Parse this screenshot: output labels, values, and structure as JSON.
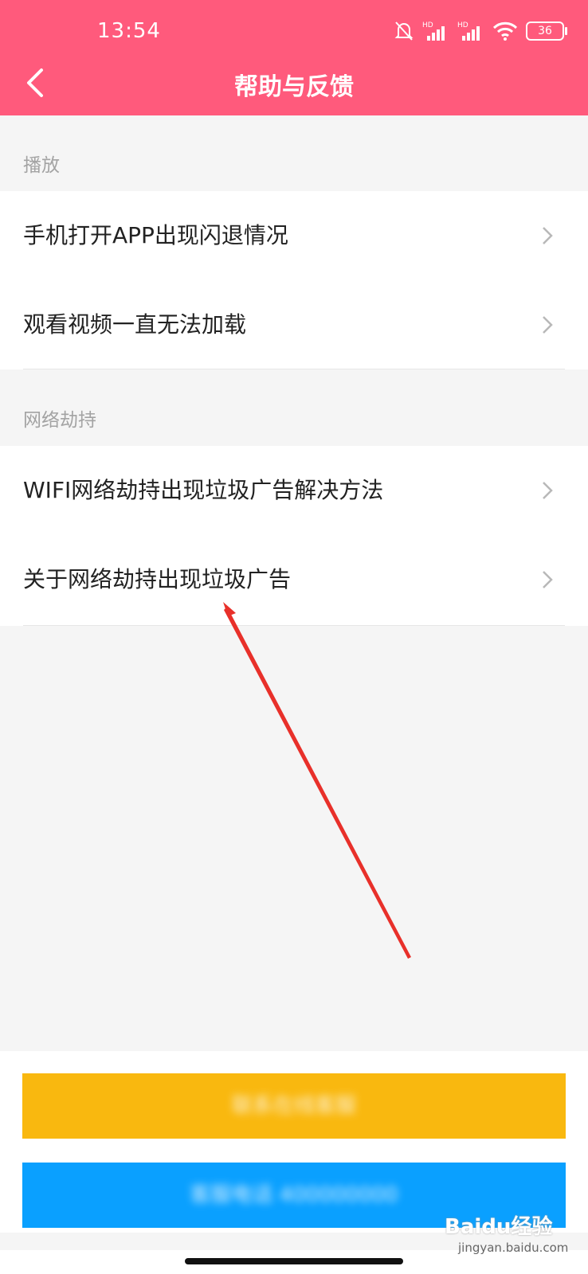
{
  "status_bar": {
    "time": "13:54",
    "battery": "36"
  },
  "nav": {
    "title": "帮助与反馈"
  },
  "sections": [
    {
      "label": "播放",
      "items": [
        "手机打开APP出现闪退情况",
        "观看视频一直无法加载"
      ]
    },
    {
      "label": "网络劫持",
      "items": [
        "WIFI网络劫持出现垃圾广告解决方法",
        "关于网络劫持出现垃圾广告"
      ]
    }
  ],
  "buttons": {
    "primary_label": "联系在线客服",
    "secondary_label": "客服电话 400000000"
  },
  "watermark": {
    "brand": "Baidu经验",
    "url": "jingyan.baidu.com"
  },
  "colors": {
    "header": "#ff5a7c",
    "button_yellow": "#f9b80f",
    "button_blue": "#0aa0ff",
    "annotation_arrow": "#e8302a"
  }
}
